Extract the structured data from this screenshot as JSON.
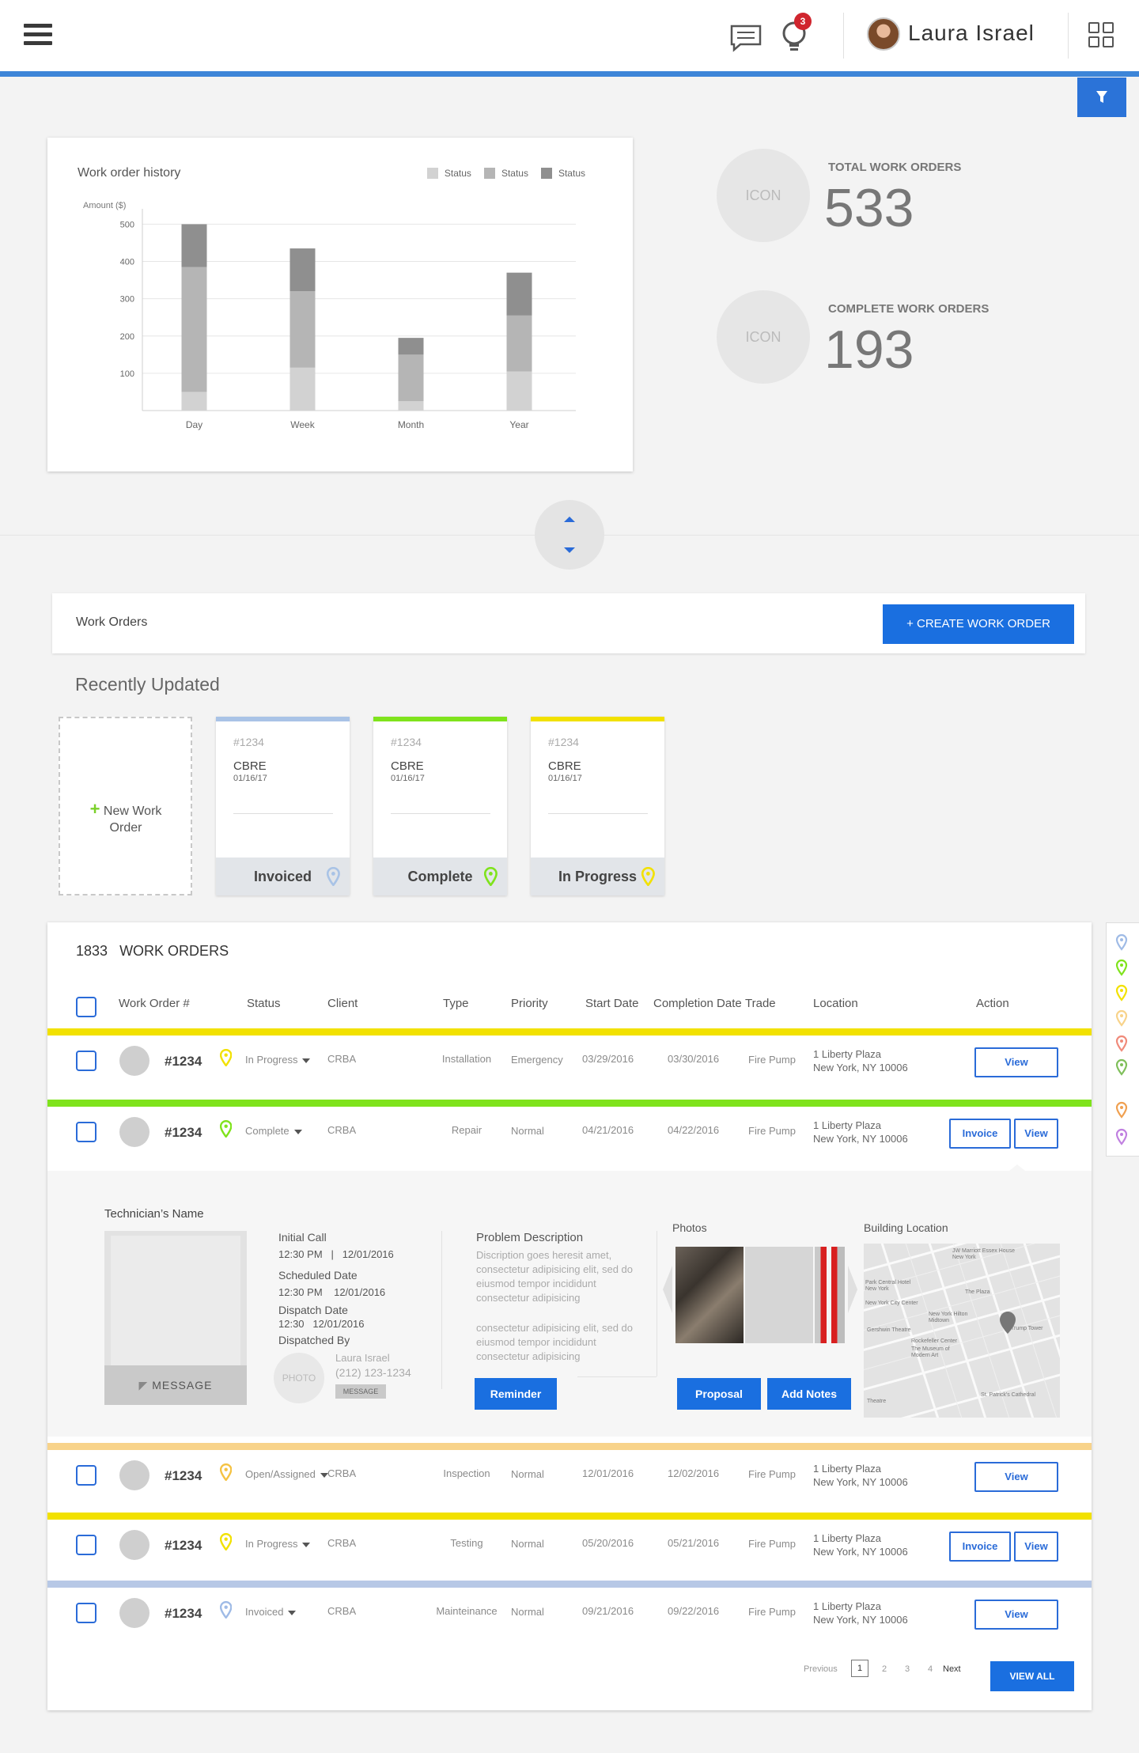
{
  "header": {
    "user_name": "Laura Israel",
    "notification_count": "3",
    "accent": "#3d85d8"
  },
  "chart": {
    "title": "Work order history",
    "legend": [
      "Status",
      "Status",
      "Status"
    ],
    "legend_colors": [
      "#d2d2d2",
      "#b5b5b5",
      "#8f8f8f"
    ]
  },
  "chart_data": {
    "type": "bar",
    "stacked": true,
    "title": "Work order history",
    "ylabel": "Amount ($)",
    "xlabel": "",
    "categories": [
      "Day",
      "Week",
      "Month",
      "Year"
    ],
    "yticks": [
      100,
      200,
      300,
      400,
      500
    ],
    "ylim": [
      0,
      520
    ],
    "grid": true,
    "legend_position": "top-right",
    "series": [
      {
        "name": "Status",
        "color": "#d2d2d2",
        "values": [
          50,
          115,
          25,
          105
        ]
      },
      {
        "name": "Status",
        "color": "#b5b5b5",
        "values": [
          335,
          205,
          125,
          150
        ]
      },
      {
        "name": "Status",
        "color": "#8f8f8f",
        "values": [
          115,
          115,
          45,
          115
        ]
      }
    ]
  },
  "stats": [
    {
      "icon": "ICON",
      "label": "TOTAL WORK ORDERS",
      "value": "533"
    },
    {
      "icon": "ICON",
      "label": "COMPLETE WORK ORDERS",
      "value": "193"
    }
  ],
  "work_orders_bar": {
    "title": "Work Orders",
    "create_label": "+ CREATE WORK ORDER"
  },
  "recent": {
    "title": "Recently Updated",
    "new_label": "New Work Order",
    "cards": [
      {
        "num": "#1234",
        "client": "CBRE",
        "date": "01/16/17",
        "status": "Invoiced",
        "color": "#a9c3e6"
      },
      {
        "num": "#1234",
        "client": "CBRE",
        "date": "01/16/17",
        "status": "Complete",
        "color": "#7fe31c"
      },
      {
        "num": "#1234",
        "client": "CBRE",
        "date": "01/16/17",
        "status": "In Progress",
        "color": "#f2e100"
      }
    ]
  },
  "table": {
    "count": "1833",
    "count_label": "WORK ORDERS",
    "headers": {
      "work_order": "Work Order #",
      "status": "Status",
      "client": "Client",
      "type": "Type",
      "priority": "Priority",
      "start": "Start Date",
      "completion": "Completion Date",
      "trade": "Trade",
      "location": "Location",
      "action": "Action"
    },
    "rows": [
      {
        "color": "#f2e100",
        "pin": "#f2e100",
        "num": "#1234",
        "status": "In Progress",
        "client": "CRBA",
        "type": "Installation",
        "priority": "Emergency",
        "start": "03/29/2016",
        "end": "03/30/2016",
        "trade": "Fire Pump",
        "loc1": "1 Liberty Plaza",
        "loc2": "New York, NY 10006",
        "view": "View",
        "invoice": ""
      },
      {
        "color": "#7fe31c",
        "pin": "#7fe31c",
        "num": "#1234",
        "status": "Complete",
        "client": "CRBA",
        "type": "Repair",
        "priority": "Normal",
        "start": "04/21/2016",
        "end": "04/22/2016",
        "trade": "Fire Pump",
        "loc1": "1 Liberty Plaza",
        "loc2": "New York, NY 10006",
        "view": "View",
        "invoice": "Invoice"
      },
      {
        "color": "#f8d38a",
        "pin": "#f5c242",
        "num": "#1234",
        "status": "Open/Assigned",
        "client": "CRBA",
        "type": "Inspection",
        "priority": "Normal",
        "start": "12/01/2016",
        "end": "12/02/2016",
        "trade": "Fire Pump",
        "loc1": "1 Liberty Plaza",
        "loc2": "New York, NY 10006",
        "view": "View",
        "invoice": ""
      },
      {
        "color": "#f2e100",
        "pin": "#f2e100",
        "num": "#1234",
        "status": "In Progress",
        "client": "CRBA",
        "type": "Testing",
        "priority": "Normal",
        "start": "05/20/2016",
        "end": "05/21/2016",
        "trade": "Fire Pump",
        "loc1": "1 Liberty Plaza",
        "loc2": "New York, NY 10006",
        "view": "View",
        "invoice": "Invoice"
      },
      {
        "color": "#b7c8e6",
        "pin": "#9fbbe6",
        "num": "#1234",
        "status": "Invoiced",
        "client": "CRBA",
        "type": "Mainteinance",
        "priority": "Normal",
        "start": "09/21/2016",
        "end": "09/22/2016",
        "trade": "Fire Pump",
        "loc1": "1 Liberty Plaza",
        "loc2": "New York, NY 10006",
        "view": "View",
        "invoice": ""
      }
    ],
    "detail": {
      "tech_label": "Technician’s Name",
      "message_label": "MESSAGE",
      "initial_call": "Initial Call",
      "initial_time": "12:30 PM   |   12/01/2016",
      "scheduled": "Scheduled Date",
      "scheduled_time": "12:30 PM    12/01/2016",
      "dispatch": "Dispatch Date",
      "dispatch_time": "12:30   12/01/2016",
      "dispatched_by": "Dispatched By",
      "photo": "PHOTO",
      "disp_name": "Laura Israel",
      "disp_phone": "(212) 123-1234",
      "disp_message": "MESSAGE",
      "problem_label": "Problem Description",
      "problem_text1": "Discription goes heresit amet, consectetur adipisicing elit, sed do eiusmod tempor incididunt consectetur adipisicing",
      "problem_text2": "consectetur adipisicing elit, sed do eiusmod tempor incididunt consectetur adipisicing",
      "reminder": "Reminder",
      "photos_label": "Photos",
      "proposal": "Proposal",
      "add_notes": "Add Notes",
      "building_label": "Building Location",
      "map_labels": [
        "JW Marriott Essex House New York",
        "Park Central Hotel New York",
        "The Plaza",
        "New York City Center",
        "New York Hilton Midtown",
        "Gershwin Theatre",
        "Rockefeller Center",
        "The Museum of Modern Art",
        "Trump Tower",
        "St. Patrick's Cathedral",
        "Theatre"
      ]
    },
    "pagination": {
      "previous": "Previous",
      "pages": [
        "1",
        "2",
        "3",
        "4"
      ],
      "next": "Next",
      "view_all": "VIEW ALL"
    }
  },
  "pin_legend": [
    "#9fbbe6",
    "#7fe31c",
    "#f2e100",
    "#f8d38a",
    "#f08a7a",
    "#7fbf5a",
    "#f0a050",
    "#c080e0"
  ]
}
